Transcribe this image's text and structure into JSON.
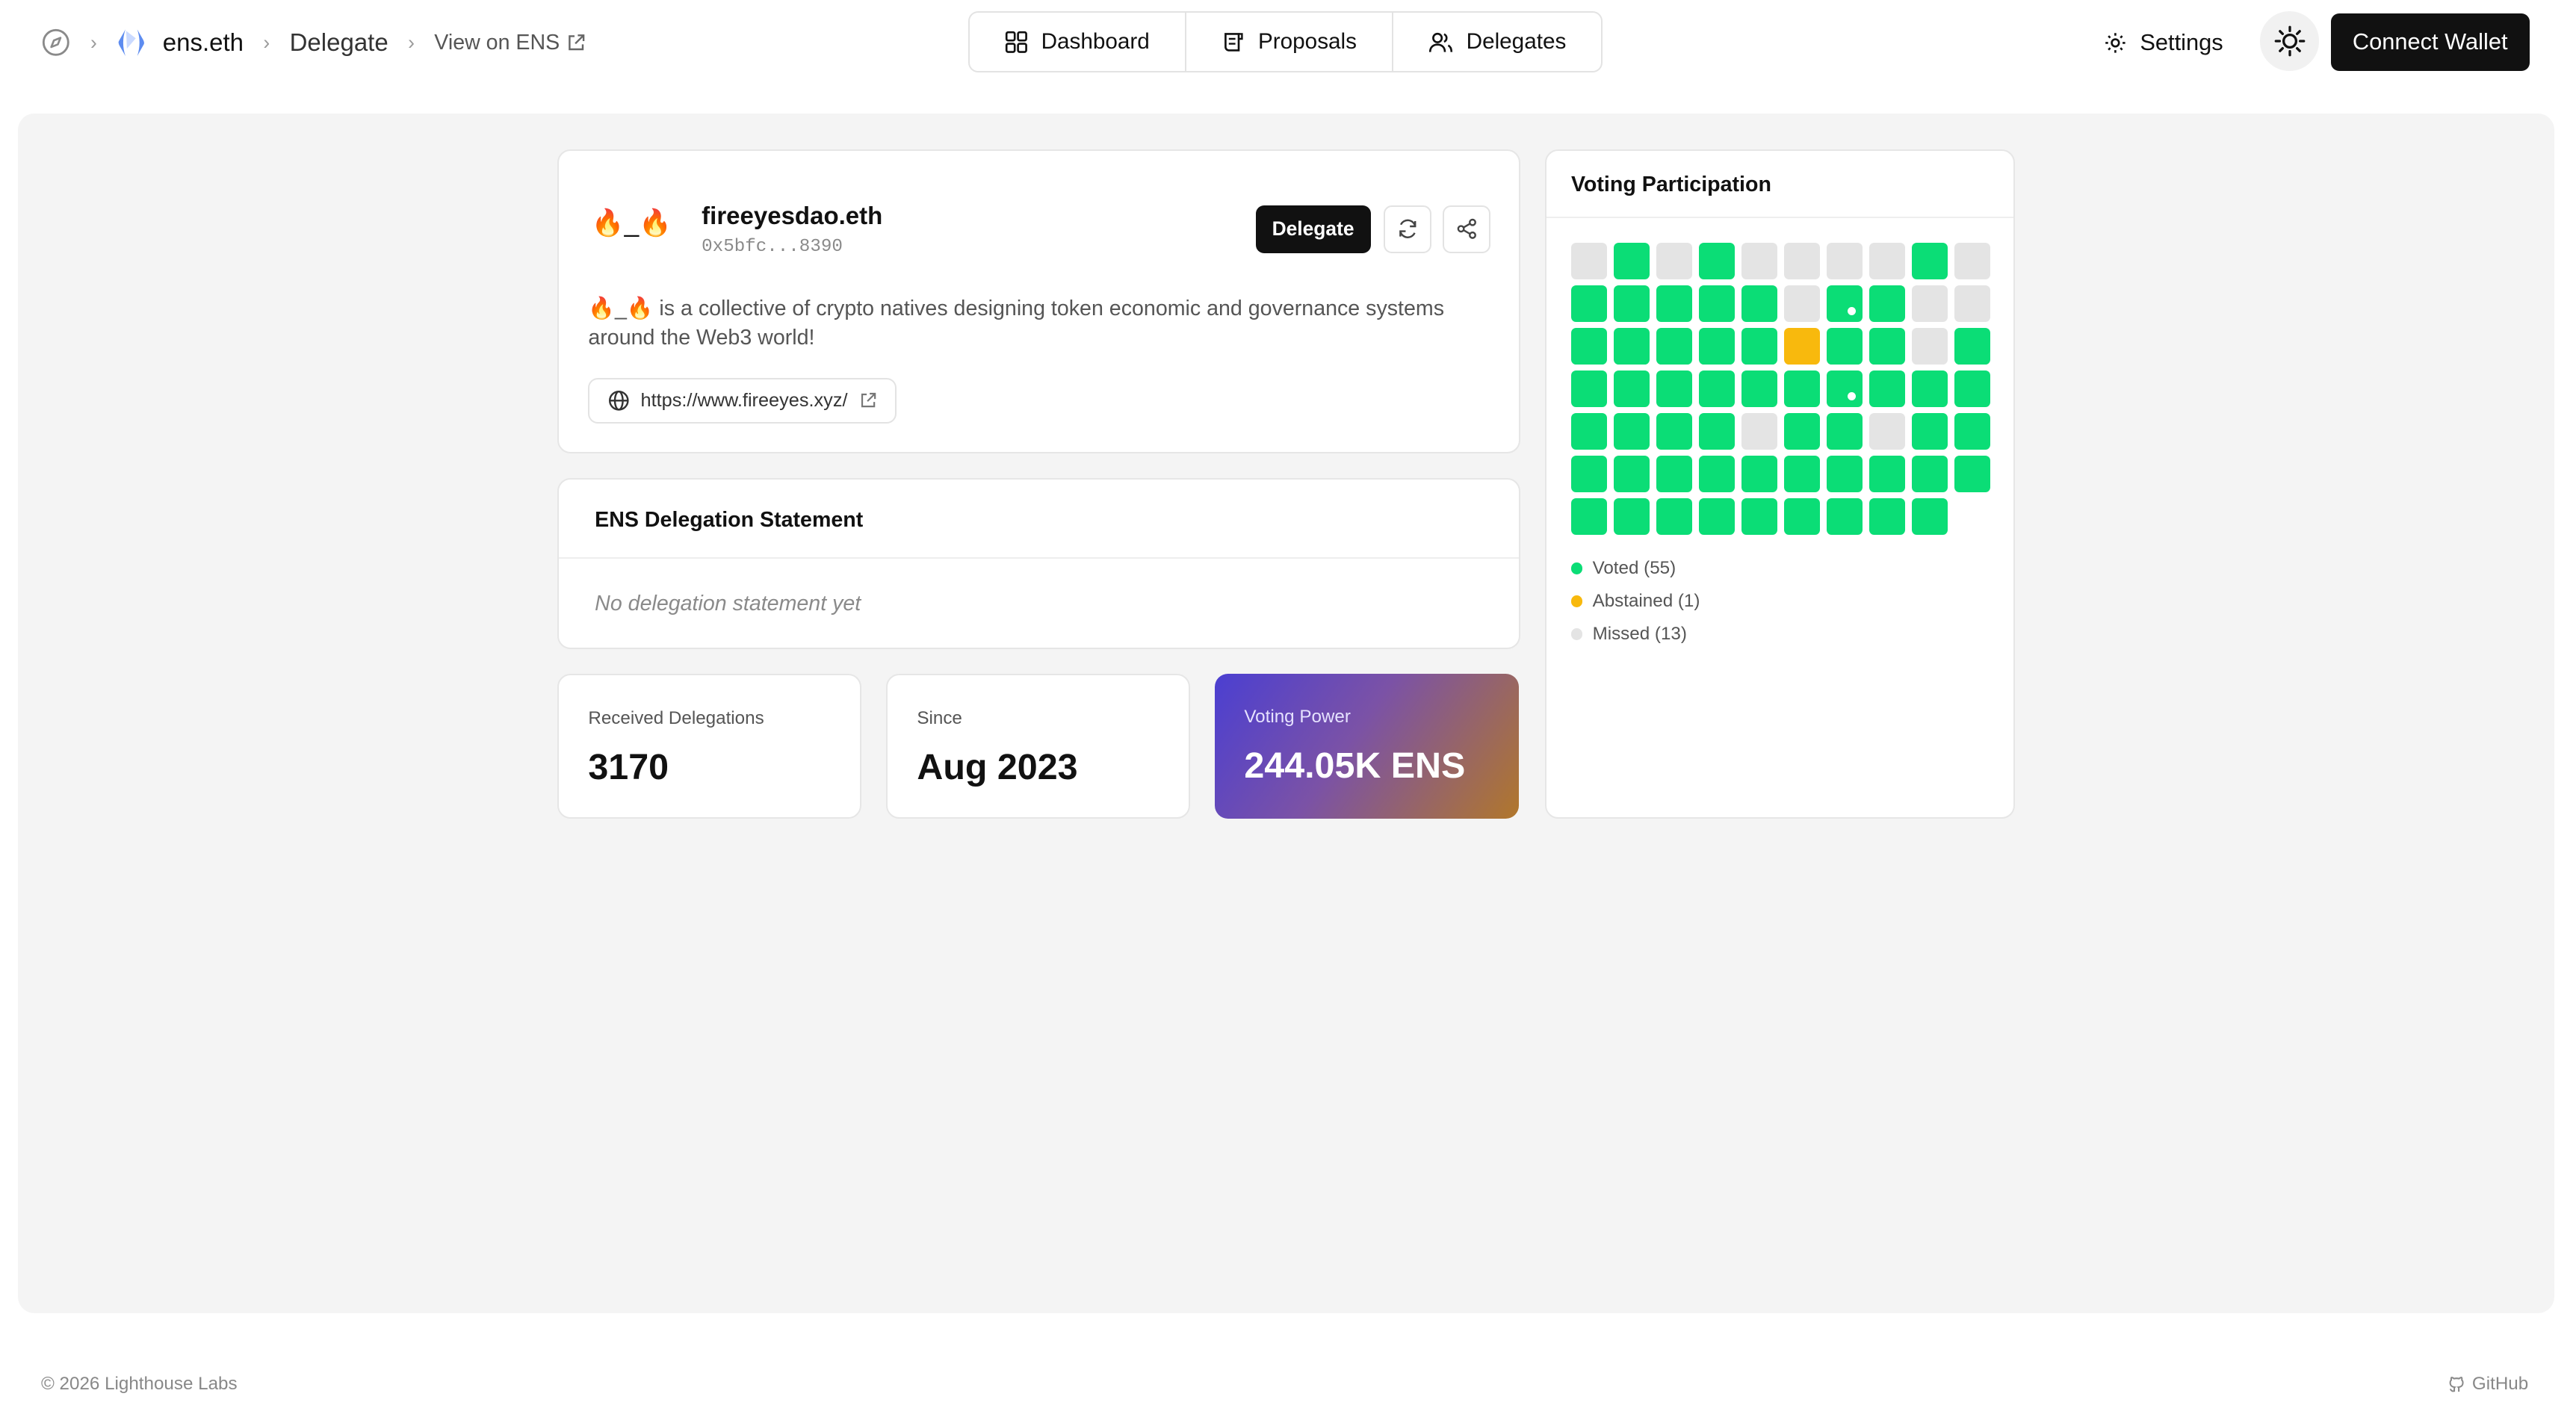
{
  "breadcrumb": {
    "home_icon": "compass-icon",
    "space_name": "ens.eth",
    "page": "Delegate",
    "external_link": "View on ENS"
  },
  "nav": {
    "tabs": [
      {
        "label": "Dashboard",
        "icon": "dashboard-icon"
      },
      {
        "label": "Proposals",
        "icon": "proposals-icon"
      },
      {
        "label": "Delegates",
        "icon": "delegates-icon"
      }
    ]
  },
  "header": {
    "settings_label": "Settings",
    "connect_wallet_label": "Connect Wallet"
  },
  "profile": {
    "avatar": "🔥_🔥",
    "name": "fireeyesdao.eth",
    "address": "0x5bfc...8390",
    "delegate_button": "Delegate",
    "bio": "🔥_🔥 is a collective of crypto natives designing token economic and governance systems around the Web3 world!",
    "website": "https://www.fireeyes.xyz/"
  },
  "statement": {
    "title": "ENS Delegation Statement",
    "empty_text": "No delegation statement yet"
  },
  "stats": [
    {
      "label": "Received Delegations",
      "value": "3170"
    },
    {
      "label": "Since",
      "value": "Aug 2023"
    },
    {
      "label": "Voting Power",
      "value": "244.05K ENS"
    }
  ],
  "voting_participation": {
    "title": "Voting Participation",
    "grid": [
      [
        "missed",
        "voted",
        "missed",
        "voted",
        "missed",
        "missed",
        "missed",
        "missed",
        "voted",
        "missed"
      ],
      [
        "voted",
        "voted",
        "voted",
        "voted",
        "voted",
        "missed",
        "voted*",
        "voted",
        "missed",
        "missed"
      ],
      [
        "voted",
        "voted",
        "voted",
        "voted",
        "voted",
        "abstain",
        "voted",
        "voted",
        "missed",
        "voted"
      ],
      [
        "voted",
        "voted",
        "voted",
        "voted",
        "voted",
        "voted",
        "voted*",
        "voted",
        "voted",
        "voted"
      ],
      [
        "voted",
        "voted",
        "voted",
        "voted",
        "missed",
        "voted",
        "voted",
        "missed",
        "voted",
        "voted"
      ],
      [
        "voted",
        "voted",
        "voted",
        "voted",
        "voted",
        "voted",
        "voted",
        "voted",
        "voted",
        "voted"
      ],
      [
        "voted",
        "voted",
        "voted",
        "voted",
        "voted",
        "voted",
        "voted",
        "voted",
        "voted"
      ]
    ],
    "legend": [
      {
        "label": "Voted (55)",
        "color": "#0bdd76"
      },
      {
        "label": "Abstained (1)",
        "color": "#f8b90d"
      },
      {
        "label": "Missed (13)",
        "color": "#e4e4e4"
      }
    ]
  },
  "footer": {
    "copyright": "© 2026 Lighthouse Labs",
    "github": "GitHub"
  }
}
